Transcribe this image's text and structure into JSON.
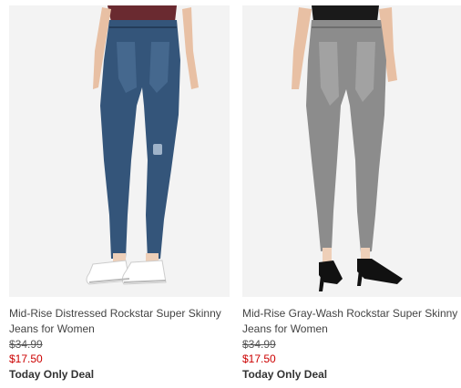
{
  "colors": {
    "sale": "#cc0000",
    "text": "#444444",
    "deal": "#333333",
    "photo_bg": "#f3f3f3"
  },
  "products": [
    {
      "name_line1": "Mid-Rise Distressed Rockstar Super Skinny",
      "name_line2": "Jeans for Women",
      "original_price": "$34.99",
      "sale_price": "$17.50",
      "deal_label": "Today Only Deal"
    },
    {
      "name_line1": "Mid-Rise Gray-Wash Rockstar Super Skinny",
      "name_line2": "Jeans for Women",
      "original_price": "$34.99",
      "sale_price": "$17.50",
      "deal_label": "Today Only Deal"
    }
  ]
}
